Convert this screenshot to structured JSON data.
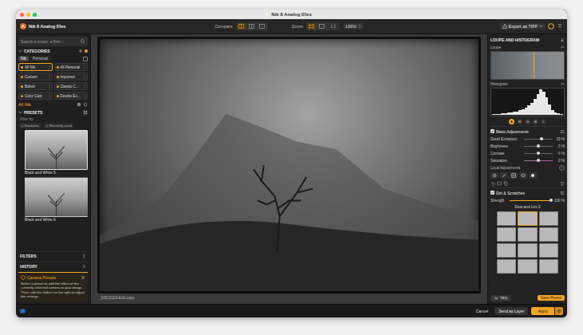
{
  "window": {
    "title": "Nik 8 Analog Efex"
  },
  "toolbar": {
    "app_name": "Nik 8 Analog Efex",
    "compare": {
      "label": "Compare",
      "modes": [
        {
          "selected": true
        },
        {
          "selected": false
        },
        {
          "selected": false
        }
      ]
    },
    "zoom": {
      "label": "Zoom",
      "modes": [
        {
          "kind": "fit",
          "selected": true
        },
        {
          "kind": "fill",
          "selected": false
        }
      ],
      "ratio": {
        "label": "1:1",
        "selected": false
      },
      "value": "136%"
    },
    "export": {
      "label": "Export as TIFF"
    }
  },
  "sidebar": {
    "search": {
      "placeholder": "Search a preset, a filter..."
    },
    "categories": {
      "title": "CATEGORIES",
      "expanded": true,
      "tabs": [
        {
          "label": "Nik",
          "selected": true
        },
        {
          "label": "Personal",
          "selected": false
        }
      ],
      "items": [
        {
          "label": "All Nik",
          "selected": true
        },
        {
          "label": "All Personal",
          "selected": false
        },
        {
          "label": "Custom",
          "selected": false
        },
        {
          "label": "Imported",
          "selected": false
        },
        {
          "label": "Bokeh",
          "selected": false
        },
        {
          "label": "Classic C...",
          "selected": false
        },
        {
          "label": "Color Cast",
          "selected": false
        },
        {
          "label": "Double Ex...",
          "selected": false
        }
      ]
    },
    "current_category": "All Nik",
    "presets": {
      "title": "PRESETS",
      "filter_label": "Filter by:",
      "filters": [
        {
          "label": "Favorites",
          "selected": false
        },
        {
          "label": "Recently used",
          "selected": false
        }
      ],
      "items": [
        {
          "name": "Black and White 5",
          "selected": true
        },
        {
          "name": "Black and White 6",
          "selected": false
        }
      ]
    },
    "sections": [
      {
        "label": "FILTERS",
        "expanded": false
      },
      {
        "label": "HISTORY",
        "expanded": false
      }
    ],
    "tip": {
      "title": "Camera Presets",
      "text": "Select a preset to add the effect of the currently selected camera to your image. Then, edit the sliders on the right to adjust the settings."
    }
  },
  "canvas": {
    "filename": "_DSC3119-Edit copy"
  },
  "panel": {
    "title": "LOUPE AND HISTOGRAM",
    "loupe": {
      "label": "Loupe",
      "expanded": true
    },
    "histogram": {
      "label": "Histogram",
      "expanded": true,
      "values": [
        2,
        3,
        4,
        5,
        6,
        8,
        10,
        12,
        14,
        18,
        22,
        28,
        36,
        48,
        62,
        80,
        100,
        92,
        70,
        40,
        20,
        10,
        5,
        2
      ],
      "channels": {
        "all": {
          "selected": true
        },
        "letters": [
          {
            "label": "R",
            "selected": false
          },
          {
            "label": "G",
            "selected": false
          },
          {
            "label": "B",
            "selected": false
          },
          {
            "label": "L",
            "selected": false
          }
        ]
      }
    },
    "basic": {
      "title": "Basic Adjustments",
      "enabled": true,
      "sliders": [
        {
          "label": "Detail Extraction",
          "reading": "33 %",
          "level": 0.62,
          "kind": "plain"
        },
        {
          "label": "Brightness",
          "reading": "0 %",
          "level": 0.5,
          "kind": "plain"
        },
        {
          "label": "Contrast",
          "reading": "0 %",
          "level": 0.5,
          "kind": "plain"
        },
        {
          "label": "Saturation",
          "reading": "0 %",
          "level": 0.5,
          "kind": "color"
        }
      ],
      "local": {
        "label": "Local Adjustments",
        "help": "?"
      }
    },
    "dirt": {
      "title": "Dirt & Scratches",
      "enabled": true,
      "strength": {
        "label": "Strength",
        "reading": "100 %",
        "level": 1
      },
      "style": "Dust and Lint 2",
      "thumbnails": [
        {
          "selected": false
        },
        {
          "selected": true
        },
        {
          "selected": false
        },
        {
          "selected": false
        },
        {
          "selected": false
        },
        {
          "selected": false
        },
        {
          "selected": false
        },
        {
          "selected": false
        },
        {
          "selected": false
        },
        {
          "selected": false
        },
        {
          "selected": false
        },
        {
          "selected": false
        }
      ]
    },
    "footer": {
      "vary": "Vary",
      "save": "Save Preset"
    }
  },
  "footer": {
    "cancel": "Cancel",
    "send": "Send as Layer",
    "apply": "Apply"
  }
}
